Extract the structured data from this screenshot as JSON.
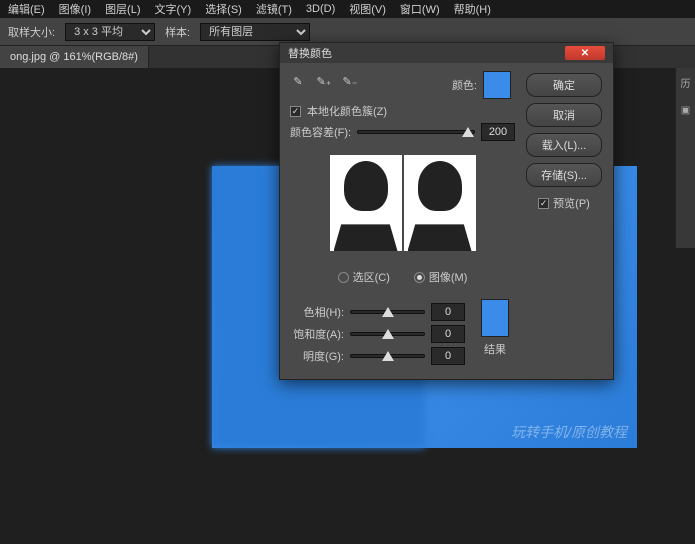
{
  "menu": {
    "items": [
      "编辑(E)",
      "图像(I)",
      "图层(L)",
      "文字(Y)",
      "选择(S)",
      "滤镜(T)",
      "3D(D)",
      "视图(V)",
      "窗口(W)",
      "帮助(H)"
    ]
  },
  "options": {
    "sample_label": "取样大小:",
    "sample_value": "3 x 3 平均",
    "sample_label2": "样本:",
    "sample2_value": "所有图层"
  },
  "tab": {
    "title": "ong.jpg @ 161%(RGB/8#)"
  },
  "dialog": {
    "title": "替换颜色",
    "ok": "确定",
    "cancel": "取消",
    "load": "载入(L)...",
    "save": "存储(S)...",
    "preview": "预览(P)",
    "color_label": "颜色:",
    "localized": "本地化颜色簇(Z)",
    "fuzziness_label": "颜色容差(F):",
    "fuzziness_value": "200",
    "radio_selection": "选区(C)",
    "radio_image": "图像(M)",
    "hue_label": "色相(H):",
    "hue_value": "0",
    "sat_label": "饱和度(A):",
    "sat_value": "0",
    "lig_label": "明度(G):",
    "lig_value": "0",
    "result": "结果",
    "color_hex": "#3a8ce8"
  },
  "rpanel": {
    "tab": "历"
  },
  "watermark": "玩转手机/原创教程"
}
